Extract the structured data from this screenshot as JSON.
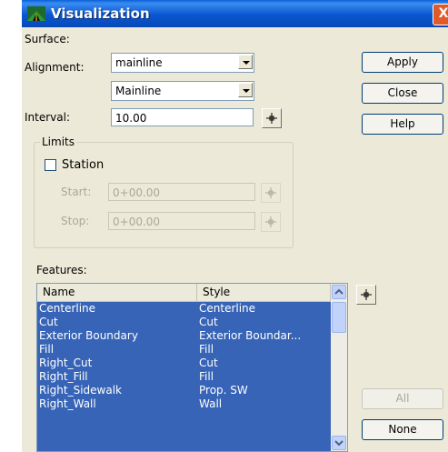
{
  "window": {
    "title": "Visualization",
    "close_glyph": "X"
  },
  "form": {
    "surface": {
      "label": "Surface:",
      "value": "mainline"
    },
    "alignment": {
      "label": "Alignment:",
      "value": "Mainline"
    },
    "interval": {
      "label": "Interval:",
      "value": "10.00"
    }
  },
  "limits": {
    "title": "Limits",
    "station_label": "Station",
    "station_checked": false,
    "start": {
      "label": "Start:",
      "value": "0+00.00"
    },
    "stop": {
      "label": "Stop:",
      "value": "0+00.00"
    }
  },
  "features": {
    "label": "Features:",
    "columns": [
      "Name",
      "Style"
    ],
    "rows": [
      {
        "name": "Centerline",
        "style": "Centerline"
      },
      {
        "name": "Cut",
        "style": "Cut"
      },
      {
        "name": "Exterior Boundary",
        "style": "Exterior Boundar..."
      },
      {
        "name": "Fill",
        "style": "Fill"
      },
      {
        "name": "Right_Cut",
        "style": "Cut"
      },
      {
        "name": "Right_Fill",
        "style": "Fill"
      },
      {
        "name": "Right_Sidewalk",
        "style": "Prop. SW"
      },
      {
        "name": "Right_Wall",
        "style": "Wall"
      }
    ]
  },
  "buttons": {
    "apply": "Apply",
    "close": "Close",
    "help": "Help",
    "all": "All",
    "none": "None"
  },
  "icons": [
    "app-icon",
    "close-icon",
    "crosshair-icon",
    "chevron-down-icon",
    "scroll-up-icon",
    "scroll-down-icon"
  ],
  "colors": {
    "titlebar": "#0a56d0",
    "selection": "#3764b7",
    "dialog": "#ece9d8"
  }
}
